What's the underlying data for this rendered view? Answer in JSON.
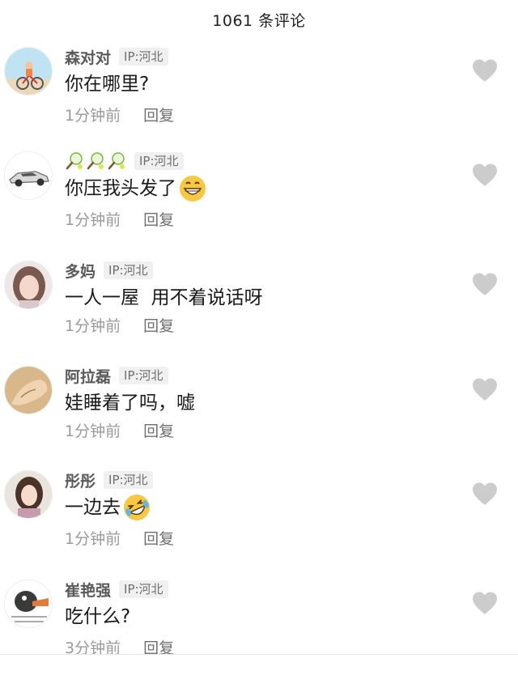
{
  "header": {
    "title": "1061 条评论"
  },
  "colors": {
    "like_gray": "#cccccc",
    "emoji_yellow": "#f7c844"
  },
  "comments": [
    {
      "username": "森对对",
      "ip": "IP:河北",
      "text": "你在哪里?",
      "time": "1分钟前",
      "reply": "回复",
      "avatar_icon": "cyclist-avatar-icon"
    },
    {
      "username": "",
      "username_icons": [
        "tennis-racket-icon",
        "tennis-racket-icon",
        "tennis-racket-icon"
      ],
      "ip": "IP:河北",
      "text": "你压我头发了",
      "emoji": "grinning-face-emoji",
      "time": "1分钟前",
      "reply": "回复",
      "avatar_icon": "sports-car-avatar-icon"
    },
    {
      "username": "多妈",
      "ip": "IP:河北",
      "text": "一人一屋  用不着说话呀",
      "time": "1分钟前",
      "reply": "回复",
      "avatar_icon": "woman-portrait-avatar-icon"
    },
    {
      "username": "阿拉磊",
      "ip": "IP:河北",
      "text": "娃睡着了吗，嘘",
      "time": "1分钟前",
      "reply": "回复",
      "avatar_icon": "hand-avatar-icon"
    },
    {
      "username": "彤彤",
      "ip": "IP:河北",
      "text": "一边去",
      "emoji": "rolling-laughing-emoji",
      "time": "1分钟前",
      "reply": "回复",
      "avatar_icon": "girl-portrait-avatar-icon"
    },
    {
      "username": "崔艳强",
      "ip": "IP:河北",
      "text": "吃什么?",
      "time": "3分钟前",
      "reply": "回复",
      "avatar_icon": "cartoon-duck-avatar-icon"
    }
  ]
}
